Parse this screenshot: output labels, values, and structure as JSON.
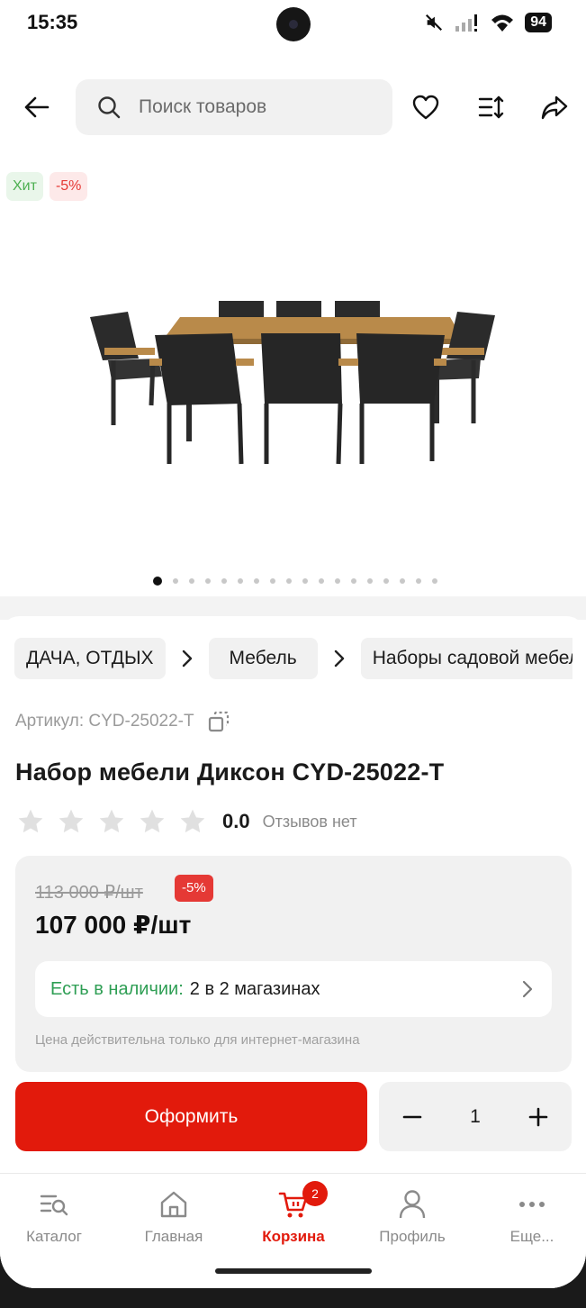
{
  "status_bar": {
    "time": "15:35",
    "battery": "94"
  },
  "search": {
    "placeholder": "Поиск товаров"
  },
  "badges": {
    "hit": "Хит",
    "discount": "-5%"
  },
  "gallery": {
    "total_images": 18,
    "active_index": 0
  },
  "breadcrumbs": [
    "ДАЧА, ОТДЫХ",
    "Мебель",
    "Наборы садовой мебели"
  ],
  "product": {
    "sku": "Артикул: CYD-25022-T",
    "title": "Набор мебели Диксон CYD-25022-T",
    "rating_value": "0.0",
    "rating_stars": 0,
    "reviews": "Отзывов нет"
  },
  "price": {
    "old": "113 000 ₽/шт",
    "discount": "-5%",
    "current": "107 000 ₽/шт",
    "stock_label": "Есть в наличии:",
    "stock_value": "2 в 2 магазинах",
    "note": "Цена действительна только для интернет-магазина"
  },
  "actions": {
    "order_label": "Оформить",
    "quantity": "1"
  },
  "nav": {
    "catalog": "Каталог",
    "home": "Главная",
    "cart": "Корзина",
    "cart_count": "2",
    "profile": "Профиль",
    "more": "Еще..."
  },
  "colors": {
    "accent": "#e21a0c",
    "stock_green": "#2e9e54",
    "hit_green": "#4caf50"
  }
}
